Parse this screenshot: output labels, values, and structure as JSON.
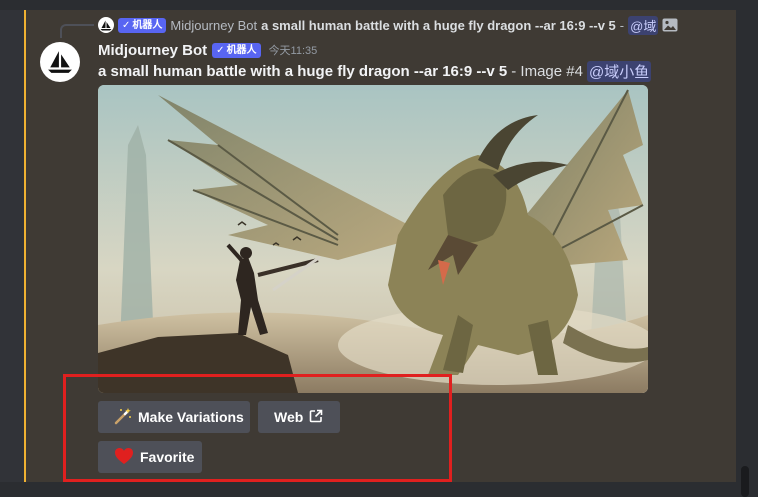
{
  "reply": {
    "author": "Midjourney Bot",
    "prompt": "a small human battle with a huge fly dragon --ar 16:9 --v 5",
    "dash": "-",
    "mention": "@域"
  },
  "badge": {
    "check": "✓",
    "label": "机器人"
  },
  "message": {
    "username": "Midjourney Bot",
    "timestamp": "今天11:35",
    "prompt": "a small human battle with a huge fly dragon --ar 16:9 --v 5",
    "suffix": "- Image #4",
    "mention": "@域小鱼"
  },
  "buttons": {
    "variations": {
      "icon": "magic-wand-icon",
      "label": "Make Variations"
    },
    "web": {
      "label": "Web",
      "icon": "external-link-icon"
    },
    "favorite": {
      "icon": "heart-icon",
      "label": "Favorite",
      "color": "#e0201f"
    }
  },
  "colors": {
    "accent_bar": "#f0b232",
    "bot_badge": "#5865f2",
    "mention_bg": "#3c4270",
    "highlight_box": "#e0201f"
  }
}
